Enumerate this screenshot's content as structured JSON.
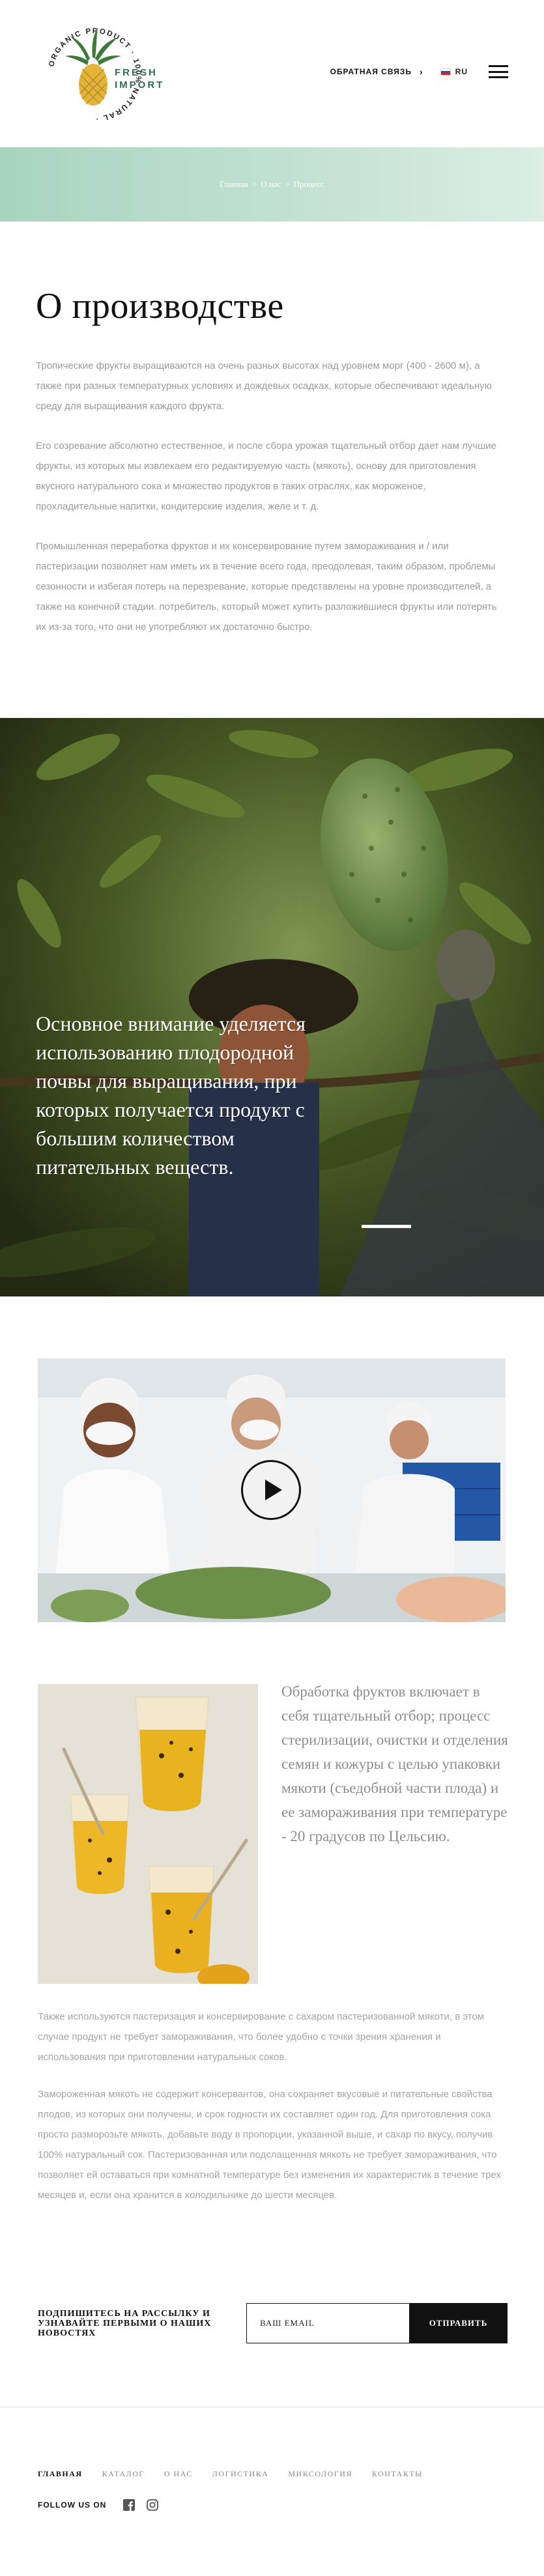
{
  "brand": {
    "ring_text": "ORGANIC PRODUCT · 100% NATURAL ·",
    "name_line1": "FRESH",
    "name_line2": "IMPORT"
  },
  "header": {
    "feedback_label": "ОБРАТНАЯ СВЯЗЬ",
    "language": "RU"
  },
  "breadcrumb": {
    "items": [
      "Главная",
      "О нас",
      "Процесс"
    ],
    "separator": ">"
  },
  "about": {
    "title": "О производстве",
    "paragraphs": [
      "Тропические фрукты выращиваются на очень разных высотах над уровнем морг (400 - 2600 м), а также при разных температурных условиях и дождевых осадках, которые обеспечивают идеальную среду для выращивания каждого фрукта.",
      "Его созревание абсолютно естественное, и после сбора урожая тщательный отбор дает нам лучшие фрукты, из которых мы извлекаем его редактируемую часть (мякоть), основу для приготовления вкусного натурального сока и множество продуктов в таких отраслях, как мороженое, прохладительные напитки, кондитерские изделия, желе и т. д.",
      "Промышленная переработка фруктов и их консервирование путем замораживания и / или пастеризации позволяет нам иметь их в течение всего года, преодолевая, таким образом, проблемы сезонности и избегая потерь на перезревание, которые представлены на уровне производителей, а также на конечной стадии. потребитель, который может купить разложившиеся фрукты или потерять их из-за того, что они не употребляют их достаточно быстро."
    ]
  },
  "hero": {
    "text": "Основное внимание уделяется использованию плодородной почвы для выращивания, при которых получается продукт с большим количеством питательных веществ."
  },
  "process": {
    "text": "Обработка фруктов включает в себя тщательный отбор; процесс стерилизации, очистки и отделения семян и кожуры с целью упаковки мякоти (съедобной части плода) и ее замораживания при температуре - 20 градусов по Цельсию.",
    "paragraphs": [
      "Также используются пастеризация и консервирование с сахаром пастеризованной мякоти, в этом случае продукт не требует замораживания, что более удобно с точки зрения хранения и использования при приготовлении натуральных соков.",
      "Замороженная мякоть не содержит консервантов, она сохраняет вкусовые и питательные свойства плодов, из которых они получены, и срок годности их составляет один год. Для приготовления сока просто разморозьте мякоть, добавьте воду в пропорции, указанной выше, и сахар по вкусу, получив 100% натуральный сок. Пастеризованная или подслащенная мякоть не требует замораживания, что позволяет ей оставаться при комнатной температуре без изменения их характеристик в течение трех месяцев и, если она хранится в холодильнике до шести месяцев."
    ]
  },
  "newsletter": {
    "label": "ПОДПИШИТЕСЬ НА РАССЫЛКУ И УЗНАВАЙТЕ ПЕРВЫМИ О НАШИХ НОВОСТЯХ",
    "placeholder": "ВАШ EMAIL",
    "button": "ОТПРАВИТЬ"
  },
  "footer": {
    "nav": [
      "ГЛАВНАЯ",
      "КАТАЛОГ",
      "О НАС",
      "ЛОГИСТИКА",
      "МИКСОЛОГИЯ",
      "КОНТАКТЫ"
    ],
    "follow_label": "FOLLOW US ON",
    "social": [
      "facebook-icon",
      "instagram-icon"
    ]
  },
  "colors": {
    "band_gradient_start": "#a7d4c0",
    "band_gradient_end": "#dceee5",
    "logo_green": "#2f6d56",
    "text_gray": "#9a9a9a"
  }
}
